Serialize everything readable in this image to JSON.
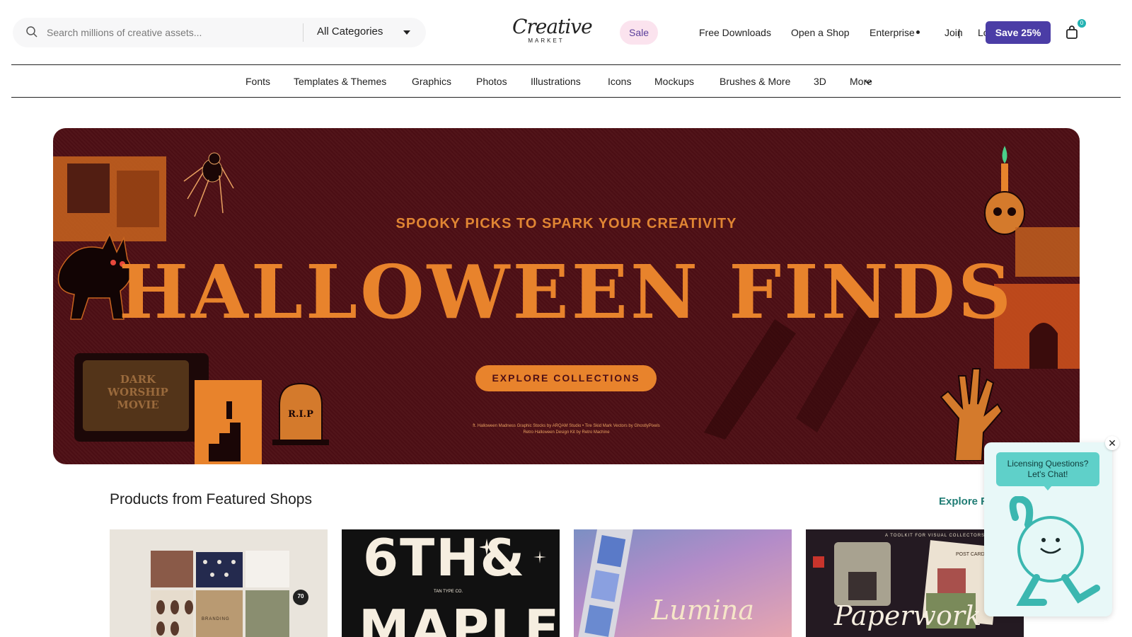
{
  "header": {
    "search": {
      "placeholder": "Search millions of creative assets...",
      "category": "All Categories"
    },
    "logo": {
      "line1": "Creative",
      "line2": "MARKET"
    },
    "sale": "Sale",
    "links": [
      "Free Downloads",
      "Open a Shop",
      "Enterprise",
      "Join",
      "Log in"
    ],
    "separator": "|",
    "save_button": "Save 25%",
    "cart_count": "0"
  },
  "category_nav": [
    "Fonts",
    "Templates & Themes",
    "Graphics",
    "Photos",
    "Illustrations",
    "Icons",
    "Mockups",
    "Brushes & More",
    "3D",
    "More"
  ],
  "hero": {
    "subtitle": "SPOOKY PICKS TO SPARK YOUR CREATIVITY",
    "title": "HALLOWEEN FINDS",
    "cta": "EXPLORE COLLECTIONS",
    "credit_line1": "ft. Halloween Madness Graphic Stocks by ARQAM Studio • Tire Skid Mark Vectors by GhostlyPixels",
    "credit_line2": "Retro Halloween Design Kit by Retro Machine",
    "tv_text": "DARK WORSHIP MOVIE",
    "tombstone_text": "R.I.P",
    "colors": {
      "background": "#4e0f15",
      "accent": "#e8832c"
    }
  },
  "featured": {
    "title": "Products from Featured Shops",
    "explore_link": "Explore F",
    "cards": [
      {
        "badge": "70",
        "label": "BRANDING"
      },
      {
        "text_top": "6TH&",
        "text_bottom": "MAPLE",
        "small": "TAN TYPE CO."
      },
      {
        "text": "Lumina"
      },
      {
        "text": "Paperwork",
        "small": "A TOOLKIT FOR VISUAL COLLECTORS",
        "post": "POST CARD"
      }
    ]
  },
  "chat": {
    "line1": "Licensing Questions?",
    "line2": "Let's Chat!",
    "close": "✕"
  }
}
